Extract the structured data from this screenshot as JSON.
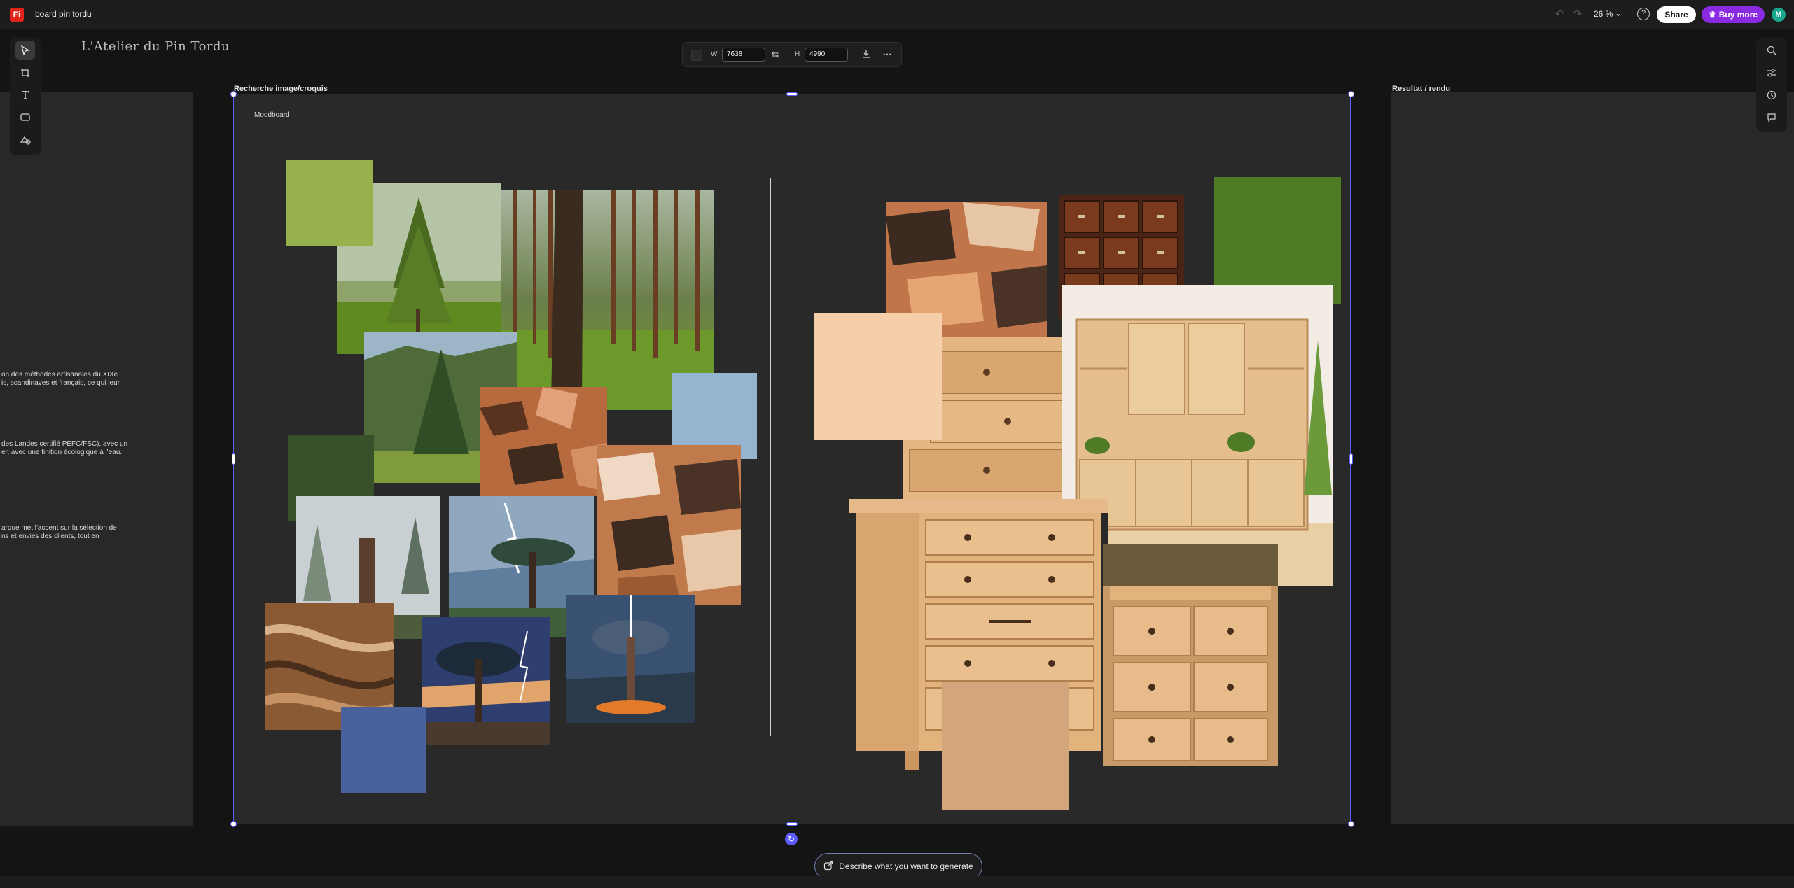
{
  "app": {
    "logo_text": "Fi",
    "doc_title": "board pin tordu",
    "zoom": "26 %",
    "share_label": "Share",
    "buy_label": "Buy more",
    "avatar_initial": "M"
  },
  "props_bar": {
    "w_label": "W",
    "w_value": "7638",
    "h_label": "H",
    "h_value": "4990"
  },
  "canvas": {
    "brand_title": "L'Atelier du Pin Tordu",
    "main_board_label": "Recherche image/croquis",
    "right_board_label": "Resultat / rendu",
    "moodboard_label": "Moodboard",
    "side_texts": [
      "on des méthodes artisanales du XIXe\nis, scandinaves et français, ce qui leur",
      "des Landes certifié PEFC/FSC), avec un\ner, avec une finition écologique à l'eau.",
      "arque met l'accent sur la sélection de\nns et envies des clients, tout en"
    ],
    "swatches": {
      "lime_green": "#97b24d",
      "dark_green": "#38512a",
      "sky_blue": "#95b4cf",
      "slate_blue": "#4a629c",
      "forest_green": "#4f7a26",
      "peach": "#f4cfa9",
      "tan": "#d2a57a"
    }
  },
  "generate": {
    "placeholder": "Describe what you want to generate"
  },
  "icons": {
    "select": "select-arrow-icon",
    "frame": "frame-crop-icon",
    "text": "text-tool-icon",
    "shape": "rectangle-tool-icon",
    "generate_fill": "generative-fill-icon"
  }
}
